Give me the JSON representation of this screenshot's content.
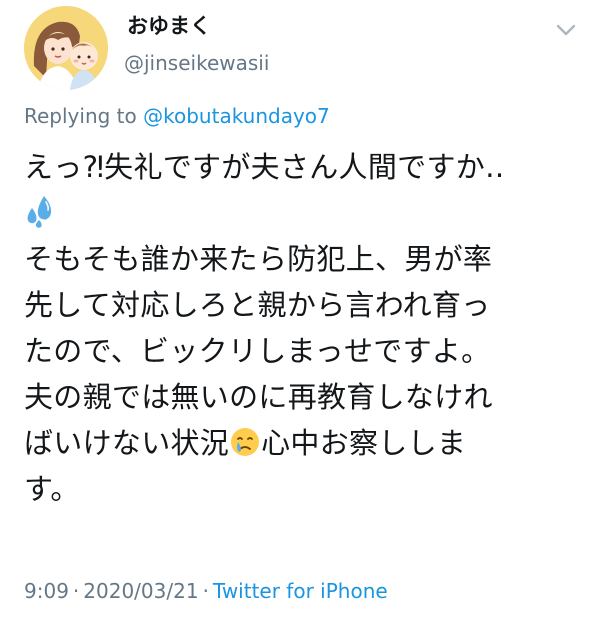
{
  "user": {
    "display_name": "おゆまく",
    "handle": "@jinseikewasii",
    "avatar_icon": "illustrated-mother-and-baby-avatar"
  },
  "menu": {
    "icon": "chevron-down-icon"
  },
  "reply": {
    "prefix": "Replying to",
    "mention": "@kobutakundayo7"
  },
  "tweet": {
    "lines": [
      "えっ⁈失礼ですが夫さん人間ですか‥",
      "",
      "そもそも誰か来たら防犯上、男が率",
      "先して対応しろと親から言われ育っ",
      "たので、ビックリしまっせですよ。",
      "夫の親では無いのに再教育しなけれ",
      "ばいけない状況",
      "心中お察ししま",
      "す。"
    ],
    "emojis": [
      "sweat-droplets-emoji",
      "crying-face-emoji"
    ]
  },
  "meta": {
    "time": "9:09",
    "separator": "·",
    "date": "2020/03/21",
    "source": "Twitter for iPhone"
  },
  "colors": {
    "primary_text": "#14171a",
    "secondary_text": "#657786",
    "link": "#1b95e0",
    "avatar_bg": "#f6d77a"
  }
}
